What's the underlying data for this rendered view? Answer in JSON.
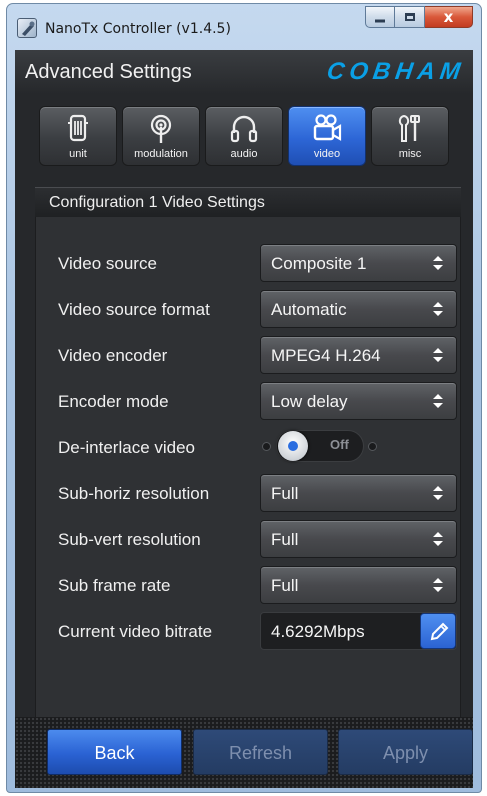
{
  "window": {
    "title": "NanoTx Controller (v1.4.5)",
    "controls": {
      "close_glyph": "x"
    }
  },
  "header": {
    "title": "Advanced Settings",
    "brand": "COBHAM",
    "brand_color": "#0aa0e6"
  },
  "tabs": [
    {
      "label": "unit",
      "icon": "device-icon",
      "active": false
    },
    {
      "label": "modulation",
      "icon": "antenna-icon",
      "active": false
    },
    {
      "label": "audio",
      "icon": "headphones-icon",
      "active": false
    },
    {
      "label": "video",
      "icon": "video-camera-icon",
      "active": true
    },
    {
      "label": "misc",
      "icon": "tools-icon",
      "active": false
    }
  ],
  "panel": {
    "title": "Configuration 1 Video Settings",
    "rows": [
      {
        "label": "Video source",
        "type": "select",
        "value": "Composite 1"
      },
      {
        "label": "Video source format",
        "type": "select",
        "value": "Automatic"
      },
      {
        "label": "Video encoder",
        "type": "select",
        "value": "MPEG4 H.264"
      },
      {
        "label": "Encoder mode",
        "type": "select",
        "value": "Low delay"
      },
      {
        "label": "De-interlace video",
        "type": "toggle",
        "value": "Off"
      },
      {
        "label": "Sub-horiz resolution",
        "type": "select",
        "value": "Full"
      },
      {
        "label": "Sub-vert resolution",
        "type": "select",
        "value": "Full"
      },
      {
        "label": "Sub frame rate",
        "type": "select",
        "value": "Full"
      },
      {
        "label": "Current video bitrate",
        "type": "readonly-edit",
        "value": "4.6292Mbps"
      }
    ]
  },
  "footer": {
    "back_label": "Back",
    "refresh_label": "Refresh",
    "apply_label": "Apply"
  },
  "colors": {
    "accent": "#2d66d6",
    "background": "#26282b",
    "panel": "#2f3134"
  }
}
